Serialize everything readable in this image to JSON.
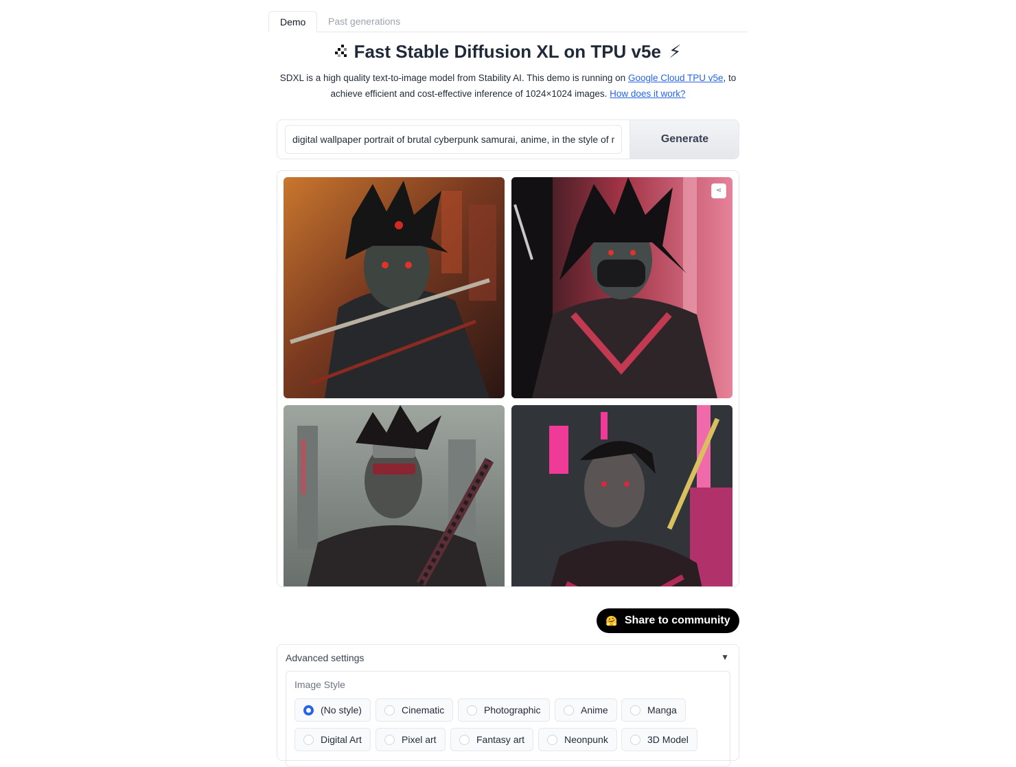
{
  "tabs": {
    "demo": "Demo",
    "past": "Past generations"
  },
  "header": {
    "title": "Fast Stable Diffusion XL on TPU v5e",
    "bolt": "⚡",
    "desc_pre": "SDXL is a high quality text-to-image model from Stability AI. This demo is running on ",
    "link1": "Google Cloud TPU v5e",
    "desc_mid": ", to achieve efficient and cost-effective inference of 1024×1024 images. ",
    "link2": "How does it work?"
  },
  "prompt": {
    "value": "digital wallpaper portrait of brutal cyberpunk samurai, anime, in the style of ming",
    "button": "Generate"
  },
  "share": {
    "label": "Share to community",
    "icon": "🤗"
  },
  "advanced": {
    "title": "Advanced settings",
    "caret": "▼",
    "style_label": "Image Style",
    "options": [
      {
        "label": "(No style)"
      },
      {
        "label": "Cinematic"
      },
      {
        "label": "Photographic"
      },
      {
        "label": "Anime"
      },
      {
        "label": "Manga"
      },
      {
        "label": "Digital Art"
      },
      {
        "label": "Pixel art"
      },
      {
        "label": "Fantasy art"
      },
      {
        "label": "Neonpunk"
      },
      {
        "label": "3D Model"
      }
    ],
    "selected": "(No style)"
  }
}
